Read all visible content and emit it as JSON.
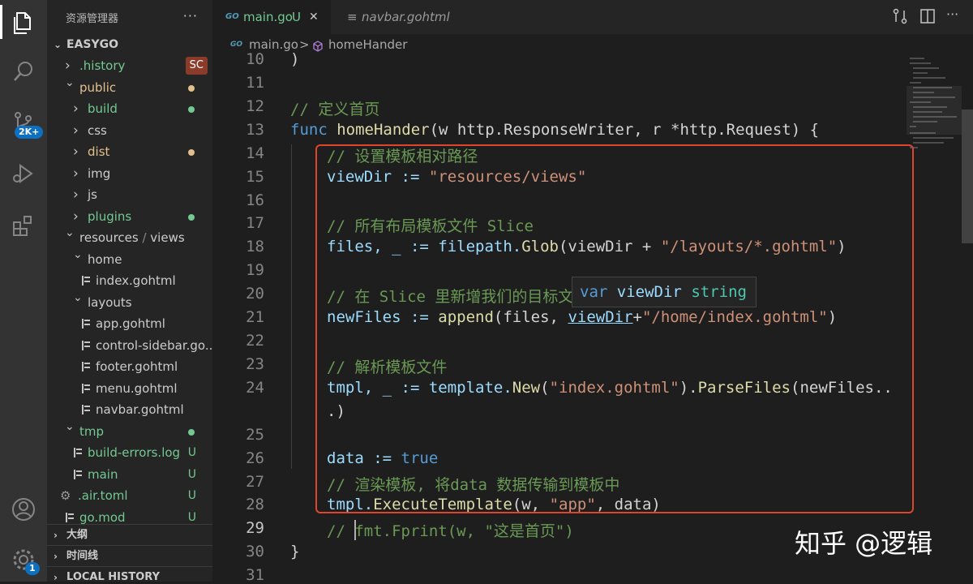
{
  "sidebar": {
    "title": "资源管理器",
    "more": "···",
    "root": "EASYGO",
    "items": [
      {
        "label": ".history",
        "mark": "SC",
        "color": "#73c991"
      },
      {
        "label": "public",
        "mark": "",
        "color": "#e2c08d"
      },
      {
        "label": "build",
        "mark": "",
        "color": "#73c991"
      },
      {
        "label": "css",
        "mark": "",
        "color": "#cccccc"
      },
      {
        "label": "dist",
        "mark": "",
        "color": "#e2c08d"
      },
      {
        "label": "img",
        "mark": "",
        "color": "#cccccc"
      },
      {
        "label": "js",
        "mark": "",
        "color": "#cccccc"
      },
      {
        "label": "plugins",
        "mark": "",
        "color": "#73c991"
      },
      {
        "label": "resources",
        "label2": "views",
        "mark": "",
        "color": "#cccccc"
      },
      {
        "label": "home",
        "mark": "",
        "color": "#cccccc"
      },
      {
        "label": "index.gohtml",
        "mark": "",
        "color": "#cccccc"
      },
      {
        "label": "layouts",
        "mark": "",
        "color": "#cccccc"
      },
      {
        "label": "app.gohtml",
        "mark": "",
        "color": "#cccccc"
      },
      {
        "label": "control-sidebar.go...",
        "mark": "",
        "color": "#cccccc"
      },
      {
        "label": "footer.gohtml",
        "mark": "",
        "color": "#cccccc"
      },
      {
        "label": "menu.gohtml",
        "mark": "",
        "color": "#cccccc"
      },
      {
        "label": "navbar.gohtml",
        "mark": "",
        "color": "#cccccc"
      },
      {
        "label": "tmp",
        "mark": "",
        "color": "#73c991"
      },
      {
        "label": "build-errors.log",
        "mark": "U",
        "color": "#73c991"
      },
      {
        "label": "main",
        "mark": "U",
        "color": "#73c991"
      },
      {
        "label": ".air.toml",
        "mark": "U",
        "color": "#73c991"
      },
      {
        "label": "go.mod",
        "mark": "U",
        "color": "#73c991"
      }
    ],
    "sections": [
      "大纲",
      "时间线",
      "LOCAL HISTORY"
    ]
  },
  "activity": {
    "scm_badge": "2K+",
    "settings_badge": "1"
  },
  "tabs": [
    {
      "label": "main.go",
      "status": "U",
      "close": "✕",
      "icon": "GO"
    },
    {
      "label": "navbar.gohtml",
      "status": "",
      "close": "",
      "icon": "≡"
    }
  ],
  "breadcrumb": {
    "file": "main.go",
    "symbol": "homeHander",
    "sep": ">"
  },
  "editor": {
    "line_numbers": [
      "10",
      "11",
      "12",
      "13",
      "14",
      "15",
      "16",
      "17",
      "18",
      "19",
      "20",
      "21",
      "22",
      "23",
      "24",
      "",
      "25",
      "26",
      "27",
      "28",
      "29",
      "30",
      "31"
    ],
    "current_line": "29",
    "hover_text": "var viewDir string",
    "hover_kw": "var",
    "hover_name": "viewDir",
    "hover_type": "string",
    "lines": {
      "l10": ")",
      "l12": "// 定义首页",
      "l13_kw": "func",
      "l13_fn": "homeHander",
      "l13_rest": "(w http.ResponseWriter, r *http.Request) {",
      "l14": "// 设置模板相对路径",
      "l15_a": "viewDir := ",
      "l15_s": "\"resources/views\"",
      "l17": "// 所有布局模板文件 Slice",
      "l18_a": "files, _ := filepath.",
      "l18_fn": "Glob",
      "l18_b": "(viewDir + ",
      "l18_s": "\"/layouts/*.gohtml\"",
      "l18_c": ")",
      "l20": "// 在 Slice 里新增我们的目标文",
      "l21_a": "newFiles := ",
      "l21_fn": "append",
      "l21_b": "(files, ",
      "l21_v": "viewDir",
      "l21_c": "+",
      "l21_s": "\"/home/index.gohtml\"",
      "l21_d": ")",
      "l23": "// 解析模板文件",
      "l24_a": "tmpl, _ := template.",
      "l24_fn": "New",
      "l24_b": "(",
      "l24_s": "\"index.gohtml\"",
      "l24_c": ").",
      "l24_fn2": "ParseFiles",
      "l24_d": "(newFiles..",
      "l24_wrap": ".)",
      "l25": "",
      "l26_a": "data := ",
      "l26_kw": "true",
      "l27": "// 渲染模板, 将data 数据传输到模板中",
      "l28_a": "tmpl.",
      "l28_fn": "ExecuteTemplate",
      "l28_b": "(w, ",
      "l28_s": "\"app\"",
      "l28_c": ", data)",
      "l29": "// fmt.Fprint(w, \"这是首页\")",
      "l30": "}"
    }
  },
  "watermark": "知乎 @逻辑"
}
